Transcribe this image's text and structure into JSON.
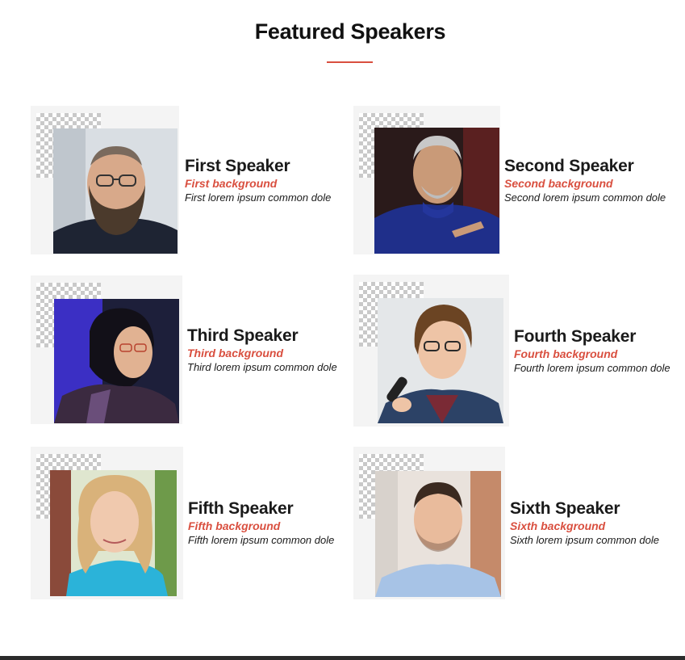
{
  "section": {
    "title": "Featured Speakers",
    "accent_color": "#d94f3f"
  },
  "speakers": [
    {
      "name": "First Speaker",
      "background": "First background",
      "description": "First lorem ipsum common dole"
    },
    {
      "name": "Second Speaker",
      "background": "Second background",
      "description": "Second lorem ipsum common dole"
    },
    {
      "name": "Third Speaker",
      "background": "Third background",
      "description": "Third lorem ipsum common dole"
    },
    {
      "name": "Fourth Speaker",
      "background": "Fourth background",
      "description": "Fourth lorem ipsum common dole"
    },
    {
      "name": "Fifth Speaker",
      "background": "Fifth background",
      "description": "Fifth lorem ipsum common dole"
    },
    {
      "name": "Sixth Speaker",
      "background": "Sixth background",
      "description": "Sixth lorem ipsum common dole"
    }
  ]
}
